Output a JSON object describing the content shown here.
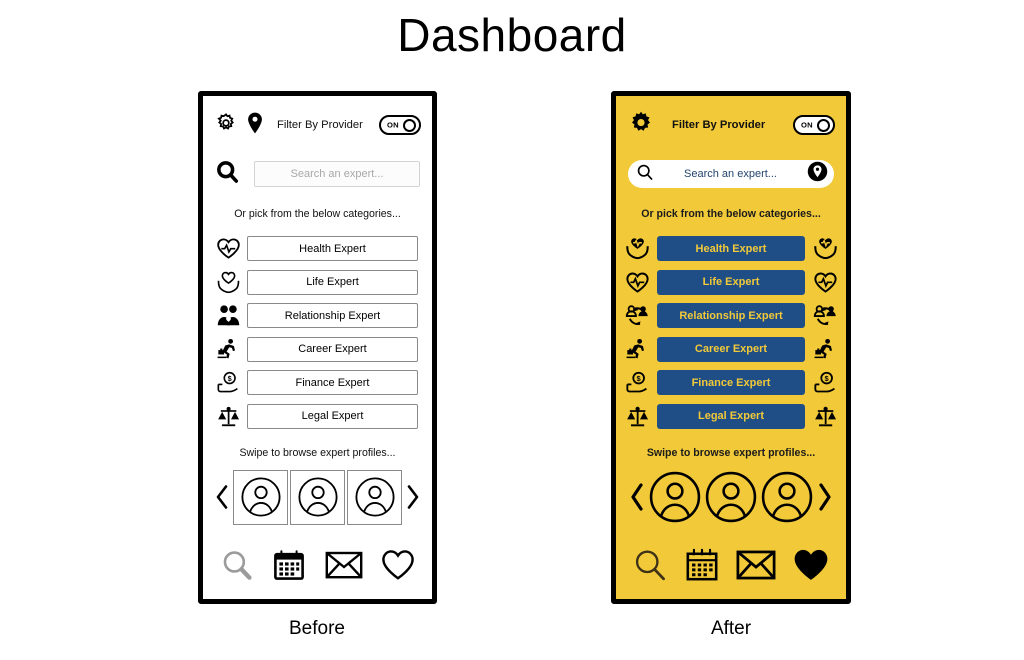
{
  "page": {
    "title": "Dashboard"
  },
  "captions": {
    "before": "Before",
    "after": "After"
  },
  "colors": {
    "after_background": "#F2C938",
    "after_button": "#1F4E87",
    "after_button_text": "#F2C938",
    "before_background": "#FFFFFF",
    "frame_border": "#000000",
    "before_placeholder": "#A8A8A8",
    "after_placeholder": "#24456E"
  },
  "before": {
    "topbar": {
      "gear_icon": "gear-icon",
      "location_icon": "location-pin-icon",
      "filter_label": "Filter By Provider",
      "toggle_state": "ON"
    },
    "search": {
      "search_icon": "search-icon",
      "placeholder": "Search an expert...",
      "value": ""
    },
    "hints": {
      "categories": "Or pick from the below categories...",
      "swipe": "Swipe to browse expert profiles..."
    },
    "categories": [
      {
        "label": "Health Expert",
        "icon": "heart-pulse-icon"
      },
      {
        "label": "Life Expert",
        "icon": "heart-in-hands-icon"
      },
      {
        "label": "Relationship Expert",
        "icon": "couple-icon"
      },
      {
        "label": "Career Expert",
        "icon": "briefcase-runner-icon"
      },
      {
        "label": "Finance Expert",
        "icon": "money-in-hand-icon"
      },
      {
        "label": "Legal Expert",
        "icon": "scales-icon"
      }
    ],
    "carousel": {
      "prev_icon": "chevron-left-icon",
      "next_icon": "chevron-right-icon",
      "avatars": [
        "avatar-icon",
        "avatar-icon",
        "avatar-icon"
      ]
    },
    "bottom_nav": [
      {
        "icon": "search-icon"
      },
      {
        "icon": "calendar-icon"
      },
      {
        "icon": "envelope-icon"
      },
      {
        "icon": "heart-icon"
      }
    ]
  },
  "after": {
    "topbar": {
      "gear_icon": "gear-icon",
      "filter_label": "Filter By Provider",
      "toggle_state": "ON"
    },
    "search": {
      "search_icon": "search-icon",
      "location_icon": "location-pin-icon",
      "placeholder": "Search an expert...",
      "value": ""
    },
    "hints": {
      "categories": "Or pick from the below categories...",
      "swipe": "Swipe to browse expert profiles..."
    },
    "categories": [
      {
        "label": "Health Expert",
        "icon": "heart-in-hands-icon"
      },
      {
        "label": "Life Expert",
        "icon": "heart-pulse-icon"
      },
      {
        "label": "Relationship Expert",
        "icon": "people-exchange-icon"
      },
      {
        "label": "Career Expert",
        "icon": "briefcase-runner-icon"
      },
      {
        "label": "Finance Expert",
        "icon": "money-in-hand-icon"
      },
      {
        "label": "Legal Expert",
        "icon": "scales-icon"
      }
    ],
    "carousel": {
      "prev_icon": "chevron-left-icon",
      "next_icon": "chevron-right-icon",
      "avatars": [
        "avatar-icon",
        "avatar-icon",
        "avatar-icon"
      ]
    },
    "bottom_nav": [
      {
        "icon": "search-icon"
      },
      {
        "icon": "calendar-icon"
      },
      {
        "icon": "envelope-icon"
      },
      {
        "icon": "heart-filled-icon"
      }
    ]
  }
}
